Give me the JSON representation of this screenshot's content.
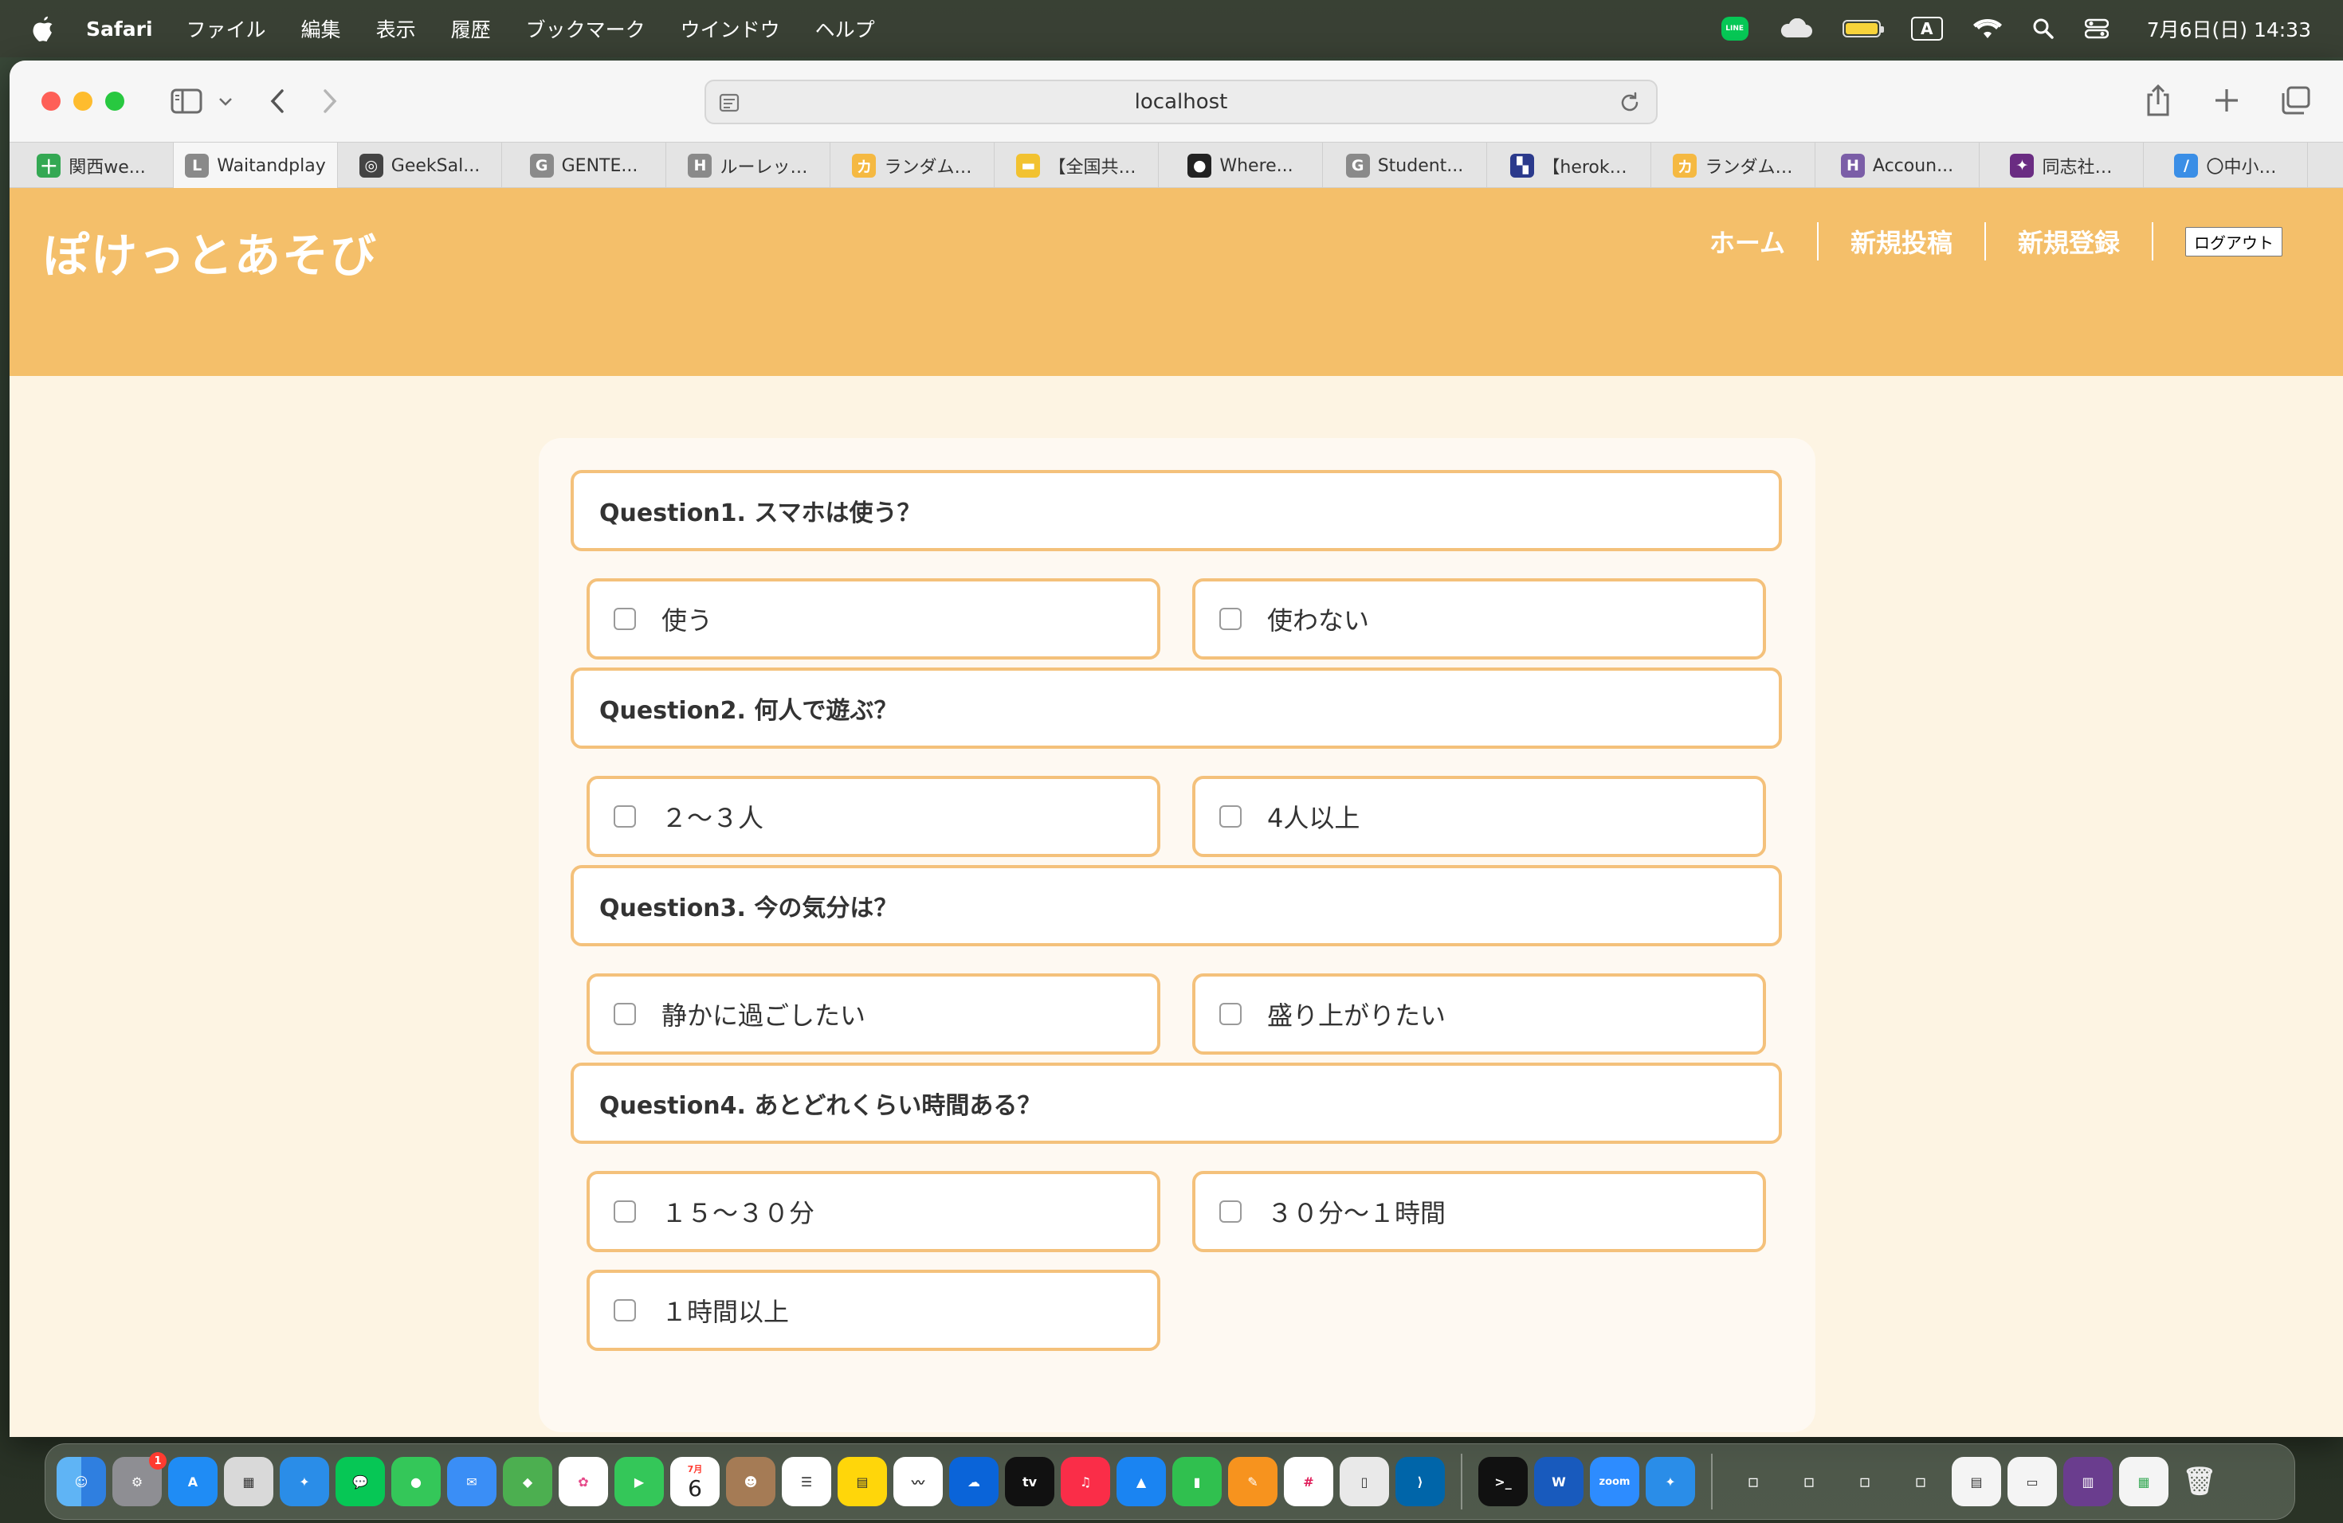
{
  "menubar": {
    "app_name": "Safari",
    "items": [
      "ファイル",
      "編集",
      "表示",
      "履歴",
      "ブックマーク",
      "ウインドウ",
      "ヘルプ"
    ],
    "line_label": "LINE",
    "input_mode": "A",
    "clock": "7月6日(日)  14:33"
  },
  "browser": {
    "url": "localhost",
    "tabs": [
      {
        "label": "関西we...",
        "fav": "十",
        "color": "#34a853"
      },
      {
        "label": "Waitandplay",
        "fav": "L",
        "color": "#8a8a8a"
      },
      {
        "label": "GeekSal...",
        "fav": "◎",
        "color": "#444444"
      },
      {
        "label": "GENTE...",
        "fav": "G",
        "color": "#8a8a8a"
      },
      {
        "label": "ルーレッ…",
        "fav": "H",
        "color": "#8a8a8a"
      },
      {
        "label": "ランダム…",
        "fav": "カ",
        "color": "#f5b942"
      },
      {
        "label": "【全国共…",
        "fav": "▬",
        "color": "#f2c230"
      },
      {
        "label": "Where...",
        "fav": "●",
        "color": "#222222"
      },
      {
        "label": "Student...",
        "fav": "G",
        "color": "#8a8a8a"
      },
      {
        "label": "【herok…",
        "fav": "▚",
        "color": "#2b3a8c"
      },
      {
        "label": "ランダム…",
        "fav": "カ",
        "color": "#f5b942"
      },
      {
        "label": "Accoun...",
        "fav": "H",
        "color": "#7b5ea7"
      },
      {
        "label": "同志社…",
        "fav": "✦",
        "color": "#6a2c82"
      },
      {
        "label": "〇中小…",
        "fav": "/",
        "color": "#3a8ee6"
      }
    ]
  },
  "site": {
    "title": "ぽけっとあそび",
    "nav": {
      "home": "ホーム",
      "new_post": "新規投稿",
      "register": "新規登録",
      "logout": "ログアウト"
    }
  },
  "quiz": {
    "questions": [
      {
        "text": "Question1. スマホは使う？",
        "options": [
          "使う",
          "使わない"
        ]
      },
      {
        "text": "Question2. 何人で遊ぶ？",
        "options": [
          "２〜３人",
          "4人以上"
        ]
      },
      {
        "text": "Question3. 今の気分は？",
        "options": [
          "静かに過ごしたい",
          "盛り上がりたい"
        ]
      },
      {
        "text": "Question4. あとどれくらい時間ある？",
        "options": [
          "１５〜３０分",
          "３０分〜１時間",
          "１時間以上"
        ]
      }
    ]
  },
  "dock": {
    "badge_count": "1",
    "calendar_month": "7月",
    "calendar_day": "6",
    "tv_label": "tv",
    "zoom_label": "zoom",
    "word_label": "W",
    "terminal_label": ">_"
  },
  "colors": {
    "header": "#f4bf6a",
    "background": "#fdf4e3",
    "border": "#f4c17b"
  }
}
